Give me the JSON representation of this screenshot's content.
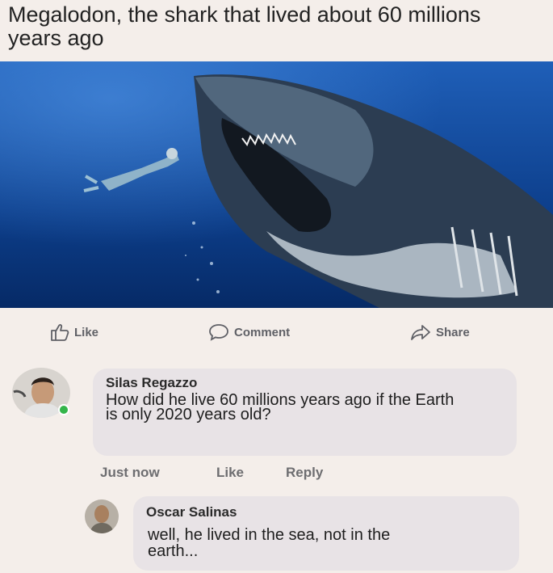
{
  "post": {
    "title": "Megalodon, the shark that lived about 60 millions years ago",
    "image_alt_icon": "shark-photo"
  },
  "actions": {
    "like_label": "Like",
    "comment_label": "Comment",
    "share_label": "Share"
  },
  "comments": [
    {
      "author": "Silas Regazzo",
      "text": "How did he live 60 millions years ago if the Earth is only 2020 years old?",
      "time": "Just now",
      "like_label": "Like",
      "reply_label": "Reply"
    },
    {
      "author": "Oscar Salinas",
      "text": "well, he lived in the sea, not in the earth..."
    }
  ],
  "colors": {
    "background": "#f4eeea",
    "bubble": "#e8e3e6",
    "ocean": "#0e3e86",
    "online": "#34b54a"
  }
}
